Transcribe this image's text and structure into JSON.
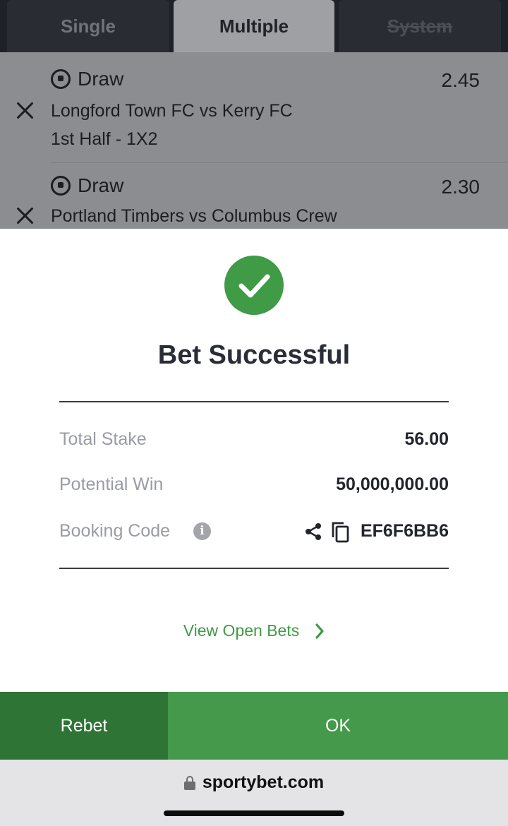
{
  "tabs": {
    "single": "Single",
    "multiple": "Multiple",
    "system": "System"
  },
  "bets": [
    {
      "pick": "Draw",
      "odds": "2.45",
      "match": "Longford Town FC vs Kerry FC",
      "market": "1st Half - 1X2"
    },
    {
      "pick": "Draw",
      "odds": "2.30",
      "match": "Portland Timbers vs Columbus Crew"
    }
  ],
  "dialog": {
    "title": "Bet Successful",
    "total_stake_label": "Total Stake",
    "total_stake_value": "56.00",
    "potential_win_label": "Potential Win",
    "potential_win_value": "50,000,000.00",
    "booking_code_label": "Booking Code",
    "booking_code_value": "EF6F6BB6",
    "view_open_bets": "View Open Bets"
  },
  "actions": {
    "rebet": "Rebet",
    "ok": "OK"
  },
  "browser": {
    "domain": "sportybet.com"
  },
  "colors": {
    "accent_green": "#3f9b45",
    "dark_green": "#2e7435",
    "ok_green": "#44994a"
  },
  "icons": [
    "close-icon",
    "soccer-ball-icon",
    "check-icon",
    "info-icon",
    "share-icon",
    "copy-icon",
    "chevron-right-icon",
    "lock-icon"
  ]
}
